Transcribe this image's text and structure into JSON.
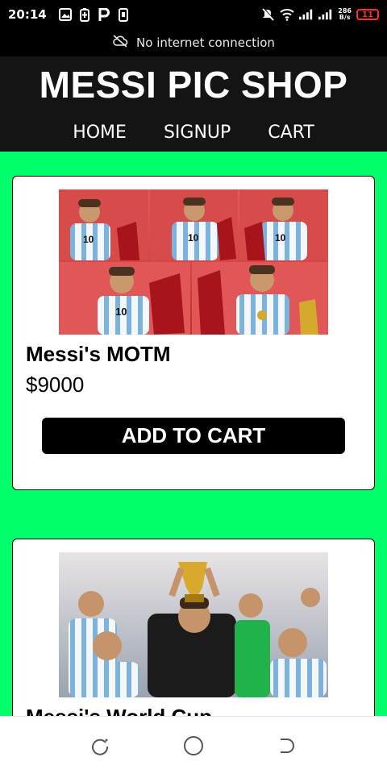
{
  "status_bar": {
    "time": "20:14",
    "net_speed_value": "286",
    "net_speed_unit": "B/s",
    "battery": "11"
  },
  "banner": {
    "text": "No internet connection"
  },
  "header": {
    "title": "MESSI PIC SHOP",
    "nav": [
      "HOME",
      "SIGNUP",
      "CART"
    ]
  },
  "products": [
    {
      "name": "Messi's MOTM",
      "price": "$9000",
      "button": "ADD TO CART"
    },
    {
      "name": "Messi's World Cup"
    }
  ],
  "colors": {
    "page_bg": "#00ff6a",
    "header_bg": "#141414",
    "button_bg": "#000000",
    "battery_low": "#ff2a2a"
  }
}
